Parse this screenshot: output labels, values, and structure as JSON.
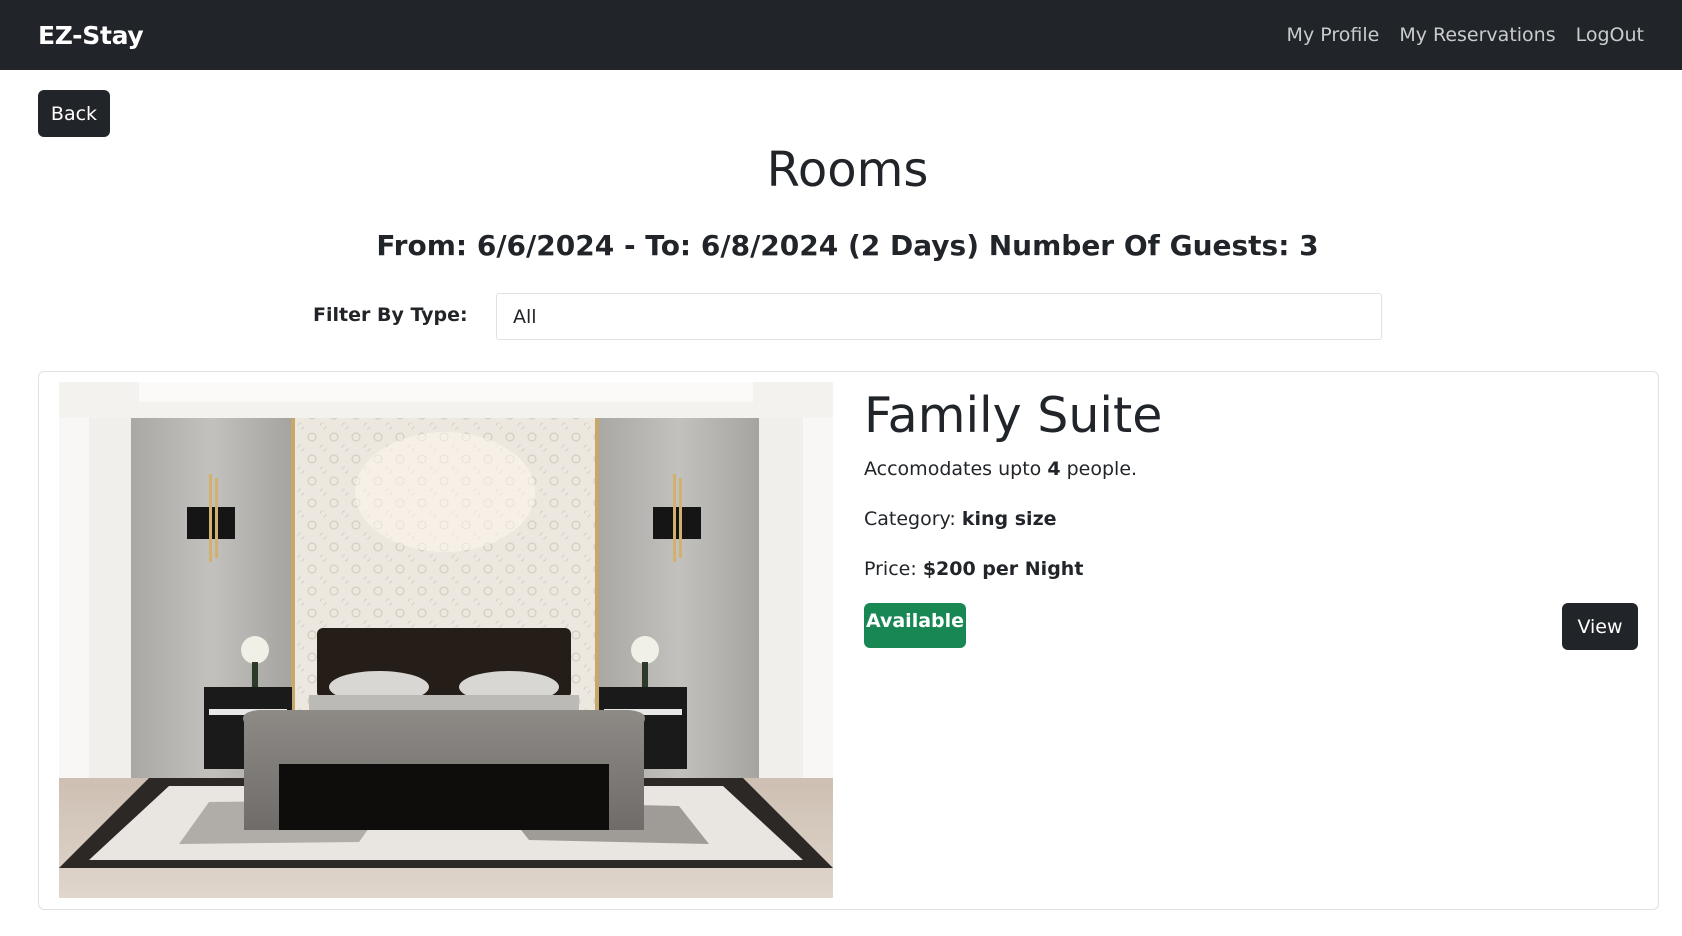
{
  "navbar": {
    "brand": "EZ-Stay",
    "links": [
      "My Profile",
      "My Reservations",
      "LogOut"
    ]
  },
  "back_label": "Back",
  "page_title": "Rooms",
  "booking_summary": "From: 6/6/2024 - To: 6/8/2024 (2 Days) Number Of Guests: 3",
  "filter": {
    "label": "Filter By Type:",
    "selected": "All"
  },
  "room": {
    "name": "Family Suite",
    "accommodates_prefix": "Accomodates upto",
    "capacity": "4",
    "accommodates_suffix": "people.",
    "category_label": "Category:",
    "category": "king size",
    "price_label": "Price:",
    "price": "$200 per Night",
    "status": "Available",
    "view_label": "View"
  },
  "colors": {
    "navbar": "#212529",
    "available": "#198754"
  }
}
